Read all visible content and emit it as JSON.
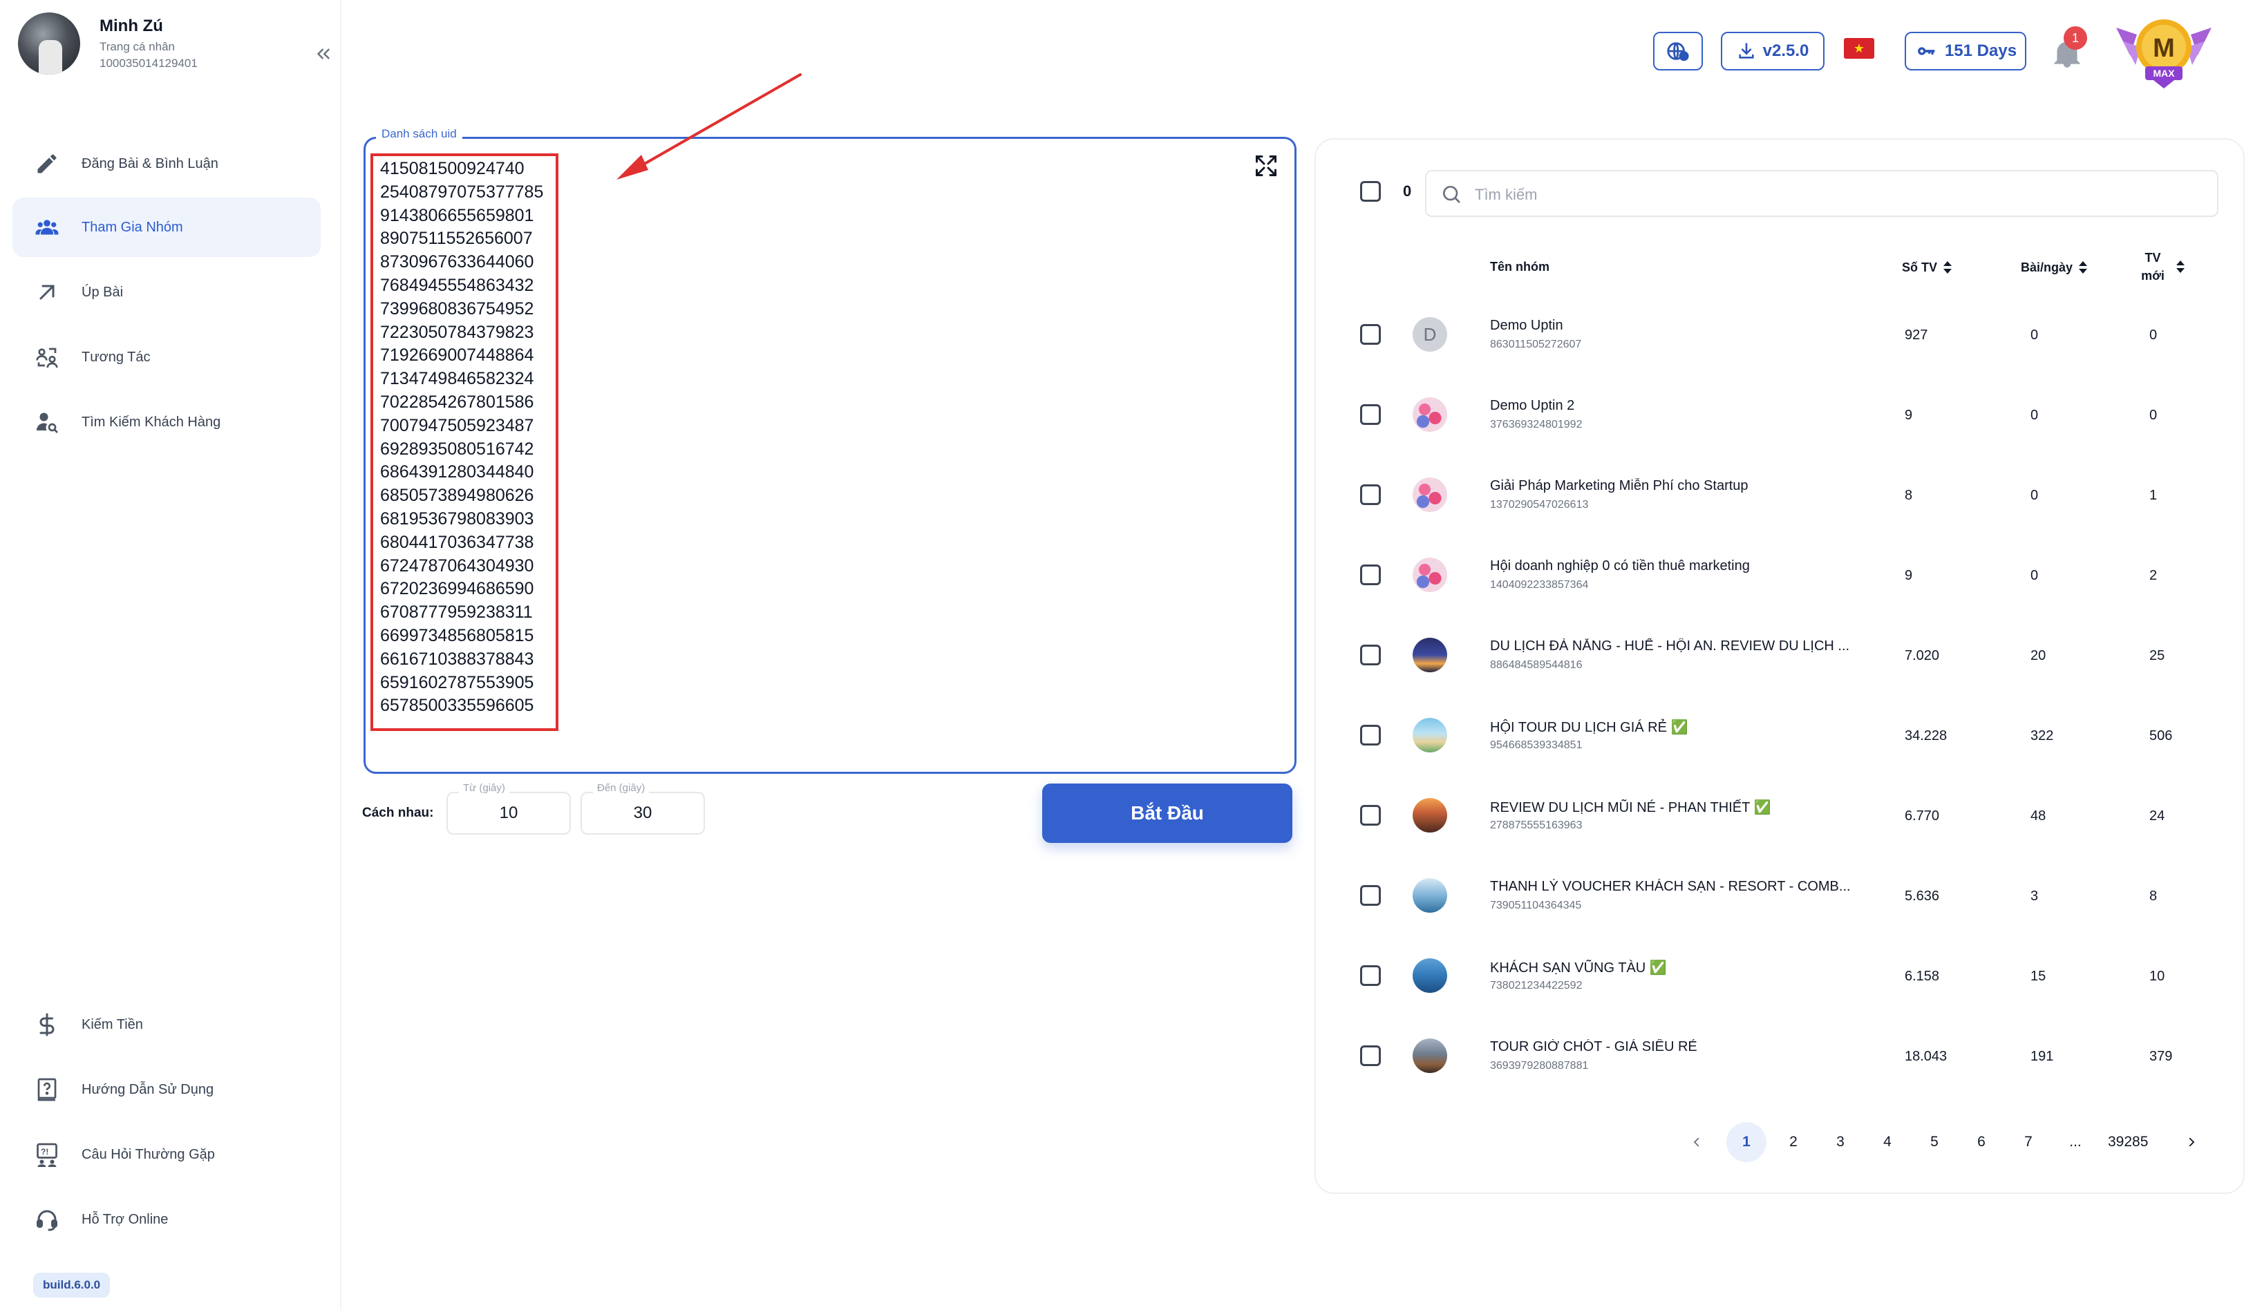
{
  "profile": {
    "name": "Minh Zú",
    "subtitle": "Trang cá nhân",
    "id": "100035014129401"
  },
  "sidebar": {
    "items": [
      {
        "label": "Đăng Bài & Bình Luận",
        "icon": "pencil-icon"
      },
      {
        "label": "Tham Gia Nhóm",
        "icon": "users-icon",
        "active": true
      },
      {
        "label": "Úp Bài",
        "icon": "arrow-up-right-icon"
      },
      {
        "label": "Tương Tác",
        "icon": "interaction-icon"
      },
      {
        "label": "Tìm Kiếm Khách Hàng",
        "icon": "user-search-icon"
      },
      {
        "label": "Kiếm Tiền",
        "icon": "dollar-icon"
      },
      {
        "label": "Hướng Dẫn Sử Dụng",
        "icon": "question-book-icon"
      },
      {
        "label": "Câu Hỏi Thường Gặp",
        "icon": "faq-icon"
      },
      {
        "label": "Hỗ Trợ Online",
        "icon": "headset-icon"
      }
    ],
    "build": "build.6.0.0"
  },
  "topbar": {
    "version": "v2.5.0",
    "days": "151 Days",
    "notifications": "1",
    "medal_letter": "M",
    "medal_text": "MAX"
  },
  "uid_panel": {
    "legend": "Danh sách uid",
    "uids": [
      "415081500924740",
      "25408797075377785",
      "9143806655659801",
      "8907511552656007",
      "8730967633644060",
      "7684945554863432",
      "7399680836754952",
      "7223050784379823",
      "7192669007448864",
      "7134749846582324",
      "7022854267801586",
      "7007947505923487",
      "6928935080516742",
      "6864391280344840",
      "6850573894980626",
      "6819536798083903",
      "6804417036347738",
      "6724787064304930",
      "6720236994686590",
      "6708777959238311",
      "6699734856805815",
      "6616710388378843",
      "6591602787553905",
      "6578500335596605"
    ]
  },
  "delay": {
    "label": "Cách nhau:",
    "from_caption": "Từ (giây)",
    "from_value": "10",
    "to_caption": "Đến (giây)",
    "to_value": "30"
  },
  "start_label": "Bắt Đầu",
  "groups": {
    "selected_count": "0",
    "search_placeholder": "Tìm kiếm",
    "columns": {
      "name": "Tên nhóm",
      "members": "Số TV",
      "posts_per_day": "Bài/ngày",
      "new_members": "TV mới"
    },
    "rows": [
      {
        "name": "Demo Uptin",
        "id": "863011505272607",
        "members": "927",
        "posts": "0",
        "new": "0",
        "avatar": "letter",
        "letter": "D"
      },
      {
        "name": "Demo Uptin 2",
        "id": "376369324801992",
        "members": "9",
        "posts": "0",
        "new": "0",
        "avatar": "flower"
      },
      {
        "name": "Giải Pháp Marketing Miễn Phí cho Startup",
        "id": "1370290547026613",
        "members": "8",
        "posts": "0",
        "new": "1",
        "avatar": "flower"
      },
      {
        "name": "Hội doanh nghiệp 0 có tiền thuê marketing",
        "id": "1404092233857364",
        "members": "9",
        "posts": "0",
        "new": "2",
        "avatar": "flower"
      },
      {
        "name": "DU LỊCH ĐÀ NẴNG - HUẾ - HỘI AN. REVIEW DU LỊCH ...",
        "id": "886484589544816",
        "members": "7.020",
        "posts": "20",
        "new": "25",
        "avatar": "night"
      },
      {
        "name": "HỘI TOUR DU LỊCH GIÁ RẺ ✅",
        "id": "954668539334851",
        "members": "34.228",
        "posts": "322",
        "new": "506",
        "avatar": "beach"
      },
      {
        "name": "REVIEW DU LỊCH MŨI NÉ - PHAN THIẾT ✅",
        "id": "278875555163963",
        "members": "6.770",
        "posts": "48",
        "new": "24",
        "avatar": "sunset"
      },
      {
        "name": "THANH LÝ VOUCHER KHÁCH SẠN - RESORT - COMB...",
        "id": "739051104364345",
        "members": "5.636",
        "posts": "3",
        "new": "8",
        "avatar": "sea"
      },
      {
        "name": "KHÁCH SẠN VŨNG TÀU ✅",
        "id": "738021234422592",
        "members": "6.158",
        "posts": "15",
        "new": "10",
        "avatar": "coast"
      },
      {
        "name": "TOUR GIỜ CHÓT - GIÁ SIÊU RẺ",
        "id": "3693979280887881",
        "members": "18.043",
        "posts": "191",
        "new": "379",
        "avatar": "mountain"
      }
    ]
  },
  "pagination": {
    "pages": [
      "1",
      "2",
      "3",
      "4",
      "5",
      "6",
      "7",
      "...",
      "39285"
    ],
    "current": "1"
  },
  "colors": {
    "accent": "#3561cf",
    "highlight": "#e0302f"
  }
}
